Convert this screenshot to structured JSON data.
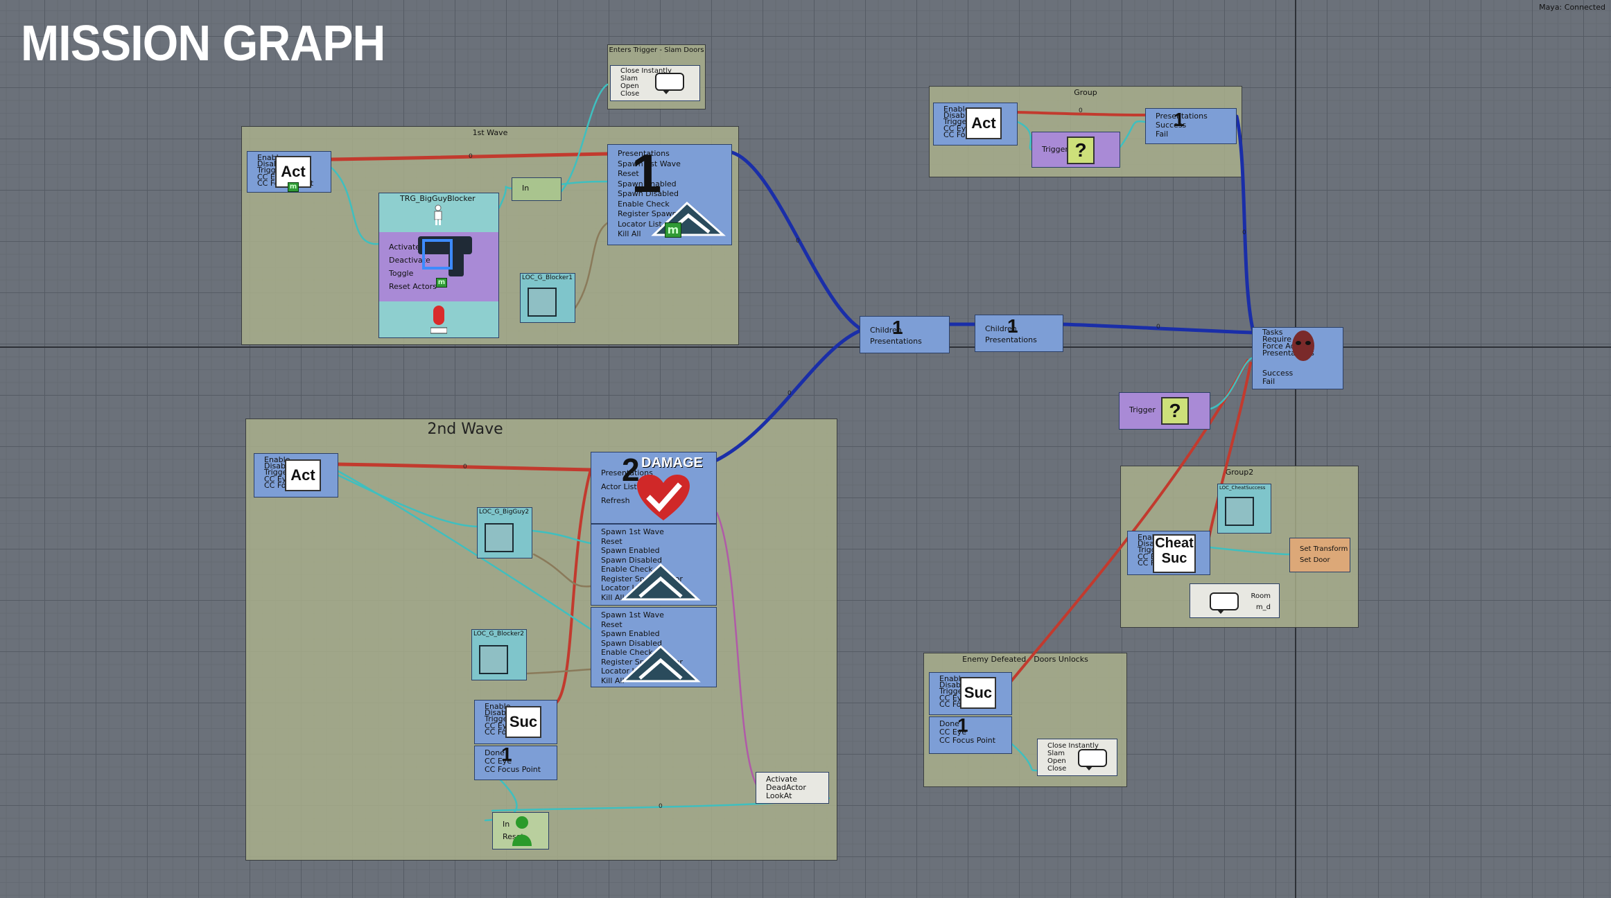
{
  "app": {
    "title": "MISSION GRAPH",
    "status": "Maya: Connected"
  },
  "groups": {
    "wave1": "1st Wave",
    "wave2": "2nd Wave",
    "enters_trigger": "Enters Trigger - Slam Doors",
    "group": "Group",
    "group2": "Group2",
    "enemy_defeated": "Enemy Defeated - Doors Unlocks"
  },
  "nodes": {
    "act_pins": [
      "Enable",
      "Disable",
      "Trigger",
      "CC Eye",
      "CC Focus Point"
    ],
    "act_label": "Act",
    "suc_label": "Suc",
    "cheat_label": [
      "Cheat",
      "Suc"
    ],
    "trg_title": "TRG_BigGuyBlocker",
    "trg_pins": [
      "Activate",
      "Deactivate",
      "Toggle",
      "Reset Actors"
    ],
    "in_label": "In",
    "spawn1_pins": [
      "Presentations",
      "Spawn 1st Wave",
      "Reset",
      "Spawn Enabled",
      "Spawn Disabled",
      "Enable Check",
      "Register Spawn Actor",
      "Locator List",
      "Kill All"
    ],
    "spawn_pins": [
      "Spawn 1st Wave",
      "Reset",
      "Spawn Enabled",
      "Spawn Disabled",
      "Enable Check",
      "Register Spawn Actor",
      "Locator List",
      "Kill All"
    ],
    "loc_blocker": "LOC_G_Blocker1",
    "loc_bigguy": "LOC_G_BigGuy2",
    "loc_blocker2": "LOC_G_Blocker2",
    "loc_cheat": "LOC_CheatSuccess",
    "damage_label": "DAMAGE",
    "damage_pins": [
      "Presentations",
      "Actor List",
      "Refresh"
    ],
    "num_one": "1",
    "num_two": "2",
    "child_pins": [
      "Children",
      "Presentations"
    ],
    "door_pins": [
      "Close Instantly",
      "Slam",
      "Open",
      "Close"
    ],
    "done_pins": [
      "Done",
      "CC Eye",
      "CC Focus Point"
    ],
    "pres_pins": [
      "Presentations",
      "Success",
      "Fail"
    ],
    "trigger_label": "Trigger",
    "tasks_pins": [
      "Tasks",
      "Require",
      "Force Add",
      "Presentations"
    ],
    "tasks_out": [
      "Success",
      "Fail"
    ],
    "activate_pins": [
      "Activate",
      "DeadActor",
      "LookAt"
    ],
    "inreset_pins": [
      "In",
      "Reset"
    ],
    "settransform_pins": [
      "Set Transform",
      "Set Door"
    ],
    "room_pins": [
      "Room",
      "m_d"
    ],
    "wire_labels": [
      "0",
      "0",
      "0",
      "0",
      "0",
      "0",
      "0",
      "0"
    ]
  },
  "colors": {
    "exec_wire": "#c23a2e",
    "data_wire": "#3fbfbf",
    "pres_wire": "#1a2ea8",
    "obj_wire": "#8a7a5a",
    "node_blue": "#7d9ed6",
    "group_bg": "#acb28c"
  },
  "icons": [
    "person-icon",
    "gun-icon",
    "capsule-icon",
    "locator-icon",
    "speech-bubble-icon",
    "damage-check-icon",
    "mountain-icon",
    "question-trigger-icon",
    "mask-icon",
    "green-figure-icon"
  ]
}
